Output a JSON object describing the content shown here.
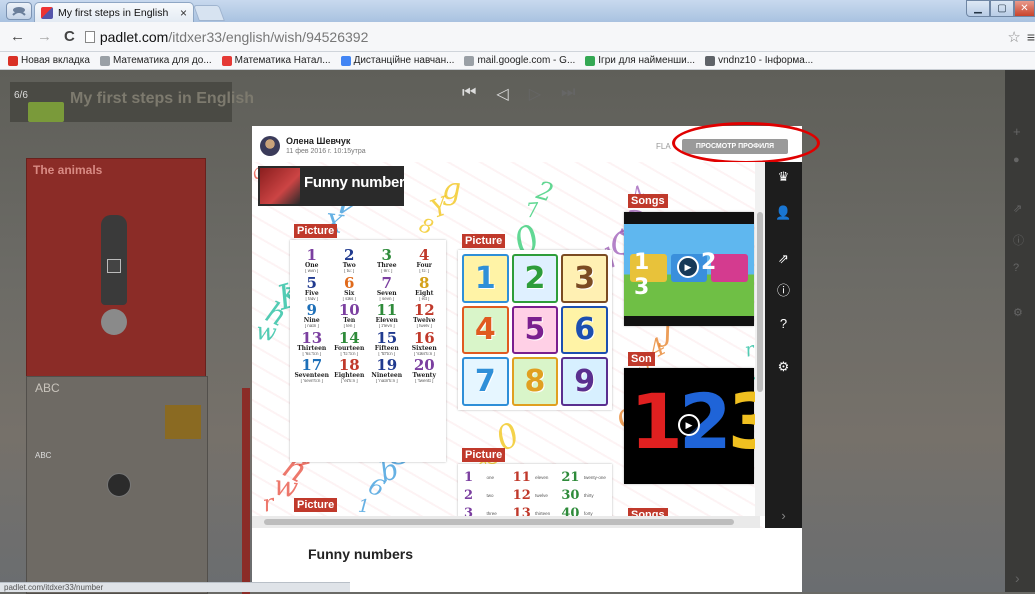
{
  "browser": {
    "tab_title": "My first steps in English",
    "tab_close": "×",
    "url_host": "padlet.com",
    "url_path": "/itdxer33/english/wish/94526392",
    "bookmarks": [
      {
        "label": "Новая вкладка",
        "color": "#d93025"
      },
      {
        "label": "Математика для до...",
        "color": "#9aa0a6"
      },
      {
        "label": "Математика Натал...",
        "color": "#e53935"
      },
      {
        "label": "Дистанційне навчан...",
        "color": "#4285f4"
      },
      {
        "label": "mail.google.com - G...",
        "color": "#9aa0a6"
      },
      {
        "label": "Ігри для найменши...",
        "color": "#34a853"
      },
      {
        "label": "vndnz10 - Інформа...",
        "color": "#5f6368"
      }
    ],
    "status_url": "padlet.com/itdxer33/number"
  },
  "board": {
    "counter": "6/6",
    "title": "My first steps in English",
    "card1_title": "The animals",
    "card2_title": "ABC",
    "card2_text": "ABC"
  },
  "modal": {
    "author": "Олена Шевчук",
    "date": "11 фев 2016 г. 10:15утра",
    "flag": "FLA",
    "profile_button": "ПРОСМОТР ПРОФИЛЯ",
    "banner_title": "Funny number",
    "footer_title": "Funny numbers",
    "labels": {
      "picture1": "Picture",
      "picture2": "Picture",
      "picture3": "Picture",
      "picture4": "Picture",
      "songs1": "Songs",
      "son": "Son",
      "songs2": "Songs"
    },
    "numbers_grid": [
      {
        "num": "1",
        "word": "One",
        "ipa": "[ wʌn ]",
        "color": "#7b3fa0"
      },
      {
        "num": "2",
        "word": "Two",
        "ipa": "[ tu: ]",
        "color": "#203a8f"
      },
      {
        "num": "3",
        "word": "Three",
        "ipa": "[ θri: ]",
        "color": "#2e8b3a"
      },
      {
        "num": "4",
        "word": "Four",
        "ipa": "[ fɔ: ]",
        "color": "#c0392b"
      },
      {
        "num": "5",
        "word": "Five",
        "ipa": "[ faɪv ]",
        "color": "#203a8f"
      },
      {
        "num": "6",
        "word": "Six",
        "ipa": "[ sɪks ]",
        "color": "#e06a1b"
      },
      {
        "num": "7",
        "word": "Seven",
        "ipa": "[ sevn ]",
        "color": "#7b3fa0"
      },
      {
        "num": "8",
        "word": "Eight",
        "ipa": "[ eɪt ]",
        "color": "#d4a017"
      },
      {
        "num": "9",
        "word": "Nine",
        "ipa": "[ naɪn ]",
        "color": "#1d6fb8"
      },
      {
        "num": "10",
        "word": "Ten",
        "ipa": "[ ten ]",
        "color": "#7b3fa0"
      },
      {
        "num": "11",
        "word": "Eleven",
        "ipa": "[ ɪ'levn ]",
        "color": "#2e8b3a"
      },
      {
        "num": "12",
        "word": "Twelve",
        "ipa": "[ twelv ]",
        "color": "#c0392b"
      },
      {
        "num": "13",
        "word": "Thirteen",
        "ipa": "[ 'θɜ:'ti:n ]",
        "color": "#7b3fa0"
      },
      {
        "num": "14",
        "word": "Fourteen",
        "ipa": "[ 'fɔ:'ti:n ]",
        "color": "#2e8b3a"
      },
      {
        "num": "15",
        "word": "Fifteen",
        "ipa": "[ 'fɪf'ti:n ]",
        "color": "#203a8f"
      },
      {
        "num": "16",
        "word": "Sixteen",
        "ipa": "[ 'sɪks'ti:n ]",
        "color": "#c0392b"
      },
      {
        "num": "17",
        "word": "Seventeen",
        "ipa": "[ 'sevn'ti:n ]",
        "color": "#1d6fb8"
      },
      {
        "num": "18",
        "word": "Eighteen",
        "ipa": "[ 'eɪ'ti:n ]",
        "color": "#c0392b"
      },
      {
        "num": "19",
        "word": "Nineteen",
        "ipa": "[ 'naɪn'ti:n ]",
        "color": "#203a8f"
      },
      {
        "num": "20",
        "word": "Twenty",
        "ipa": "[ 'twentɪ ]",
        "color": "#7b3fa0"
      }
    ],
    "tiles": [
      {
        "num": "1",
        "color": "#2f8fd8",
        "bg": "#fff3a6"
      },
      {
        "num": "2",
        "color": "#2e9d3a",
        "bg": "#dff0ff"
      },
      {
        "num": "3",
        "color": "#7b4b22",
        "bg": "#fff0b3"
      },
      {
        "num": "4",
        "color": "#e05a20",
        "bg": "#d9f5c9"
      },
      {
        "num": "5",
        "color": "#7a1f8f",
        "bg": "#ffd0e6"
      },
      {
        "num": "6",
        "color": "#1d4fb0",
        "bg": "#fff3a6"
      },
      {
        "num": "7",
        "color": "#2f8fd8",
        "bg": "#e6f6ff"
      },
      {
        "num": "8",
        "color": "#e0a020",
        "bg": "#d9f5c9"
      },
      {
        "num": "9",
        "color": "#5a2f8f",
        "bg": "#d7f0ff"
      }
    ],
    "small_list": [
      {
        "a": "1",
        "b": "11",
        "c": "21"
      },
      {
        "a": "2",
        "b": "12",
        "c": "30"
      },
      {
        "a": "3",
        "b": "13",
        "c": "40"
      }
    ],
    "small_list_words": [
      {
        "a": "one",
        "b": "eleven",
        "c": "twenty-one"
      },
      {
        "a": "two",
        "b": "twelve",
        "c": "thirty"
      },
      {
        "a": "three",
        "b": "thirteen",
        "c": "forty"
      }
    ],
    "video1_numbers": "1 2 3",
    "video2_numbers": "123",
    "accent": "#c0392b"
  }
}
